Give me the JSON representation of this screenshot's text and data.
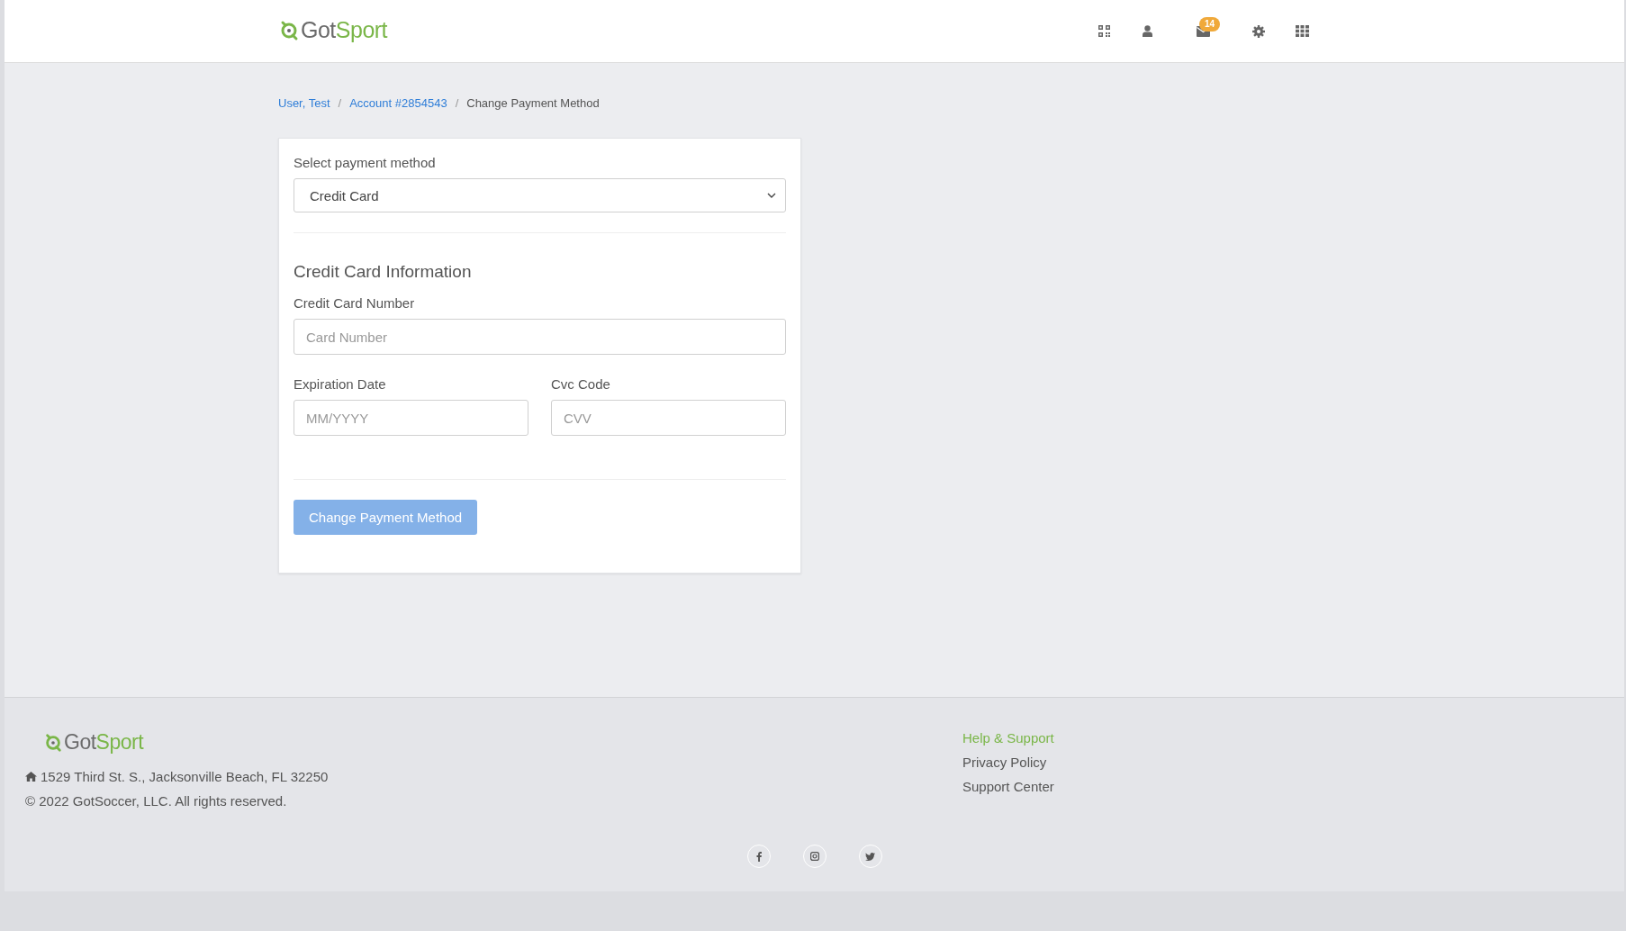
{
  "header": {
    "logo": [
      "Got",
      "Sport"
    ],
    "icons": [
      {
        "kind": "qr"
      },
      {
        "kind": "user"
      },
      {
        "kind": "mail",
        "badge": "14"
      },
      {
        "kind": "gear"
      },
      {
        "kind": "grid"
      }
    ]
  },
  "breadcrumb": [
    {
      "label": "User, Test",
      "kind": "link"
    },
    {
      "label": "Account #2854543",
      "kind": "link",
      "separator": "/"
    },
    {
      "label": "Change Payment Method",
      "kind": "current",
      "separator": "/"
    }
  ],
  "form": {
    "payment_method": {
      "label": "Select payment method",
      "value": "Credit Card"
    },
    "section_title": "Credit Card Information",
    "fields": [
      {
        "label": "Credit Card Number",
        "placeholder": "Card Number",
        "kind": "wide"
      },
      {
        "label": "Expiration Date",
        "placeholder": "MM/YYYY",
        "kind": "half"
      },
      {
        "label": "Cvc Code",
        "placeholder": "CVV",
        "kind": "half"
      }
    ],
    "submit": {
      "label": "Change Payment Method",
      "disabled": true
    }
  },
  "footer": {
    "logo": [
      "Got",
      "Sport"
    ],
    "address": "1529 Third St. S., Jacksonville Beach, FL 32250",
    "copyright": "© 2022 GotSoccer, LLC. All rights reserved.",
    "links": [
      {
        "label": "Help & Support",
        "kind": "heading"
      },
      {
        "label": "Privacy Policy",
        "kind": "link"
      },
      {
        "label": "Support Center",
        "kind": "link"
      }
    ],
    "social": [
      {
        "kind": "facebook"
      },
      {
        "kind": "instagram"
      },
      {
        "kind": "twitter"
      }
    ]
  }
}
